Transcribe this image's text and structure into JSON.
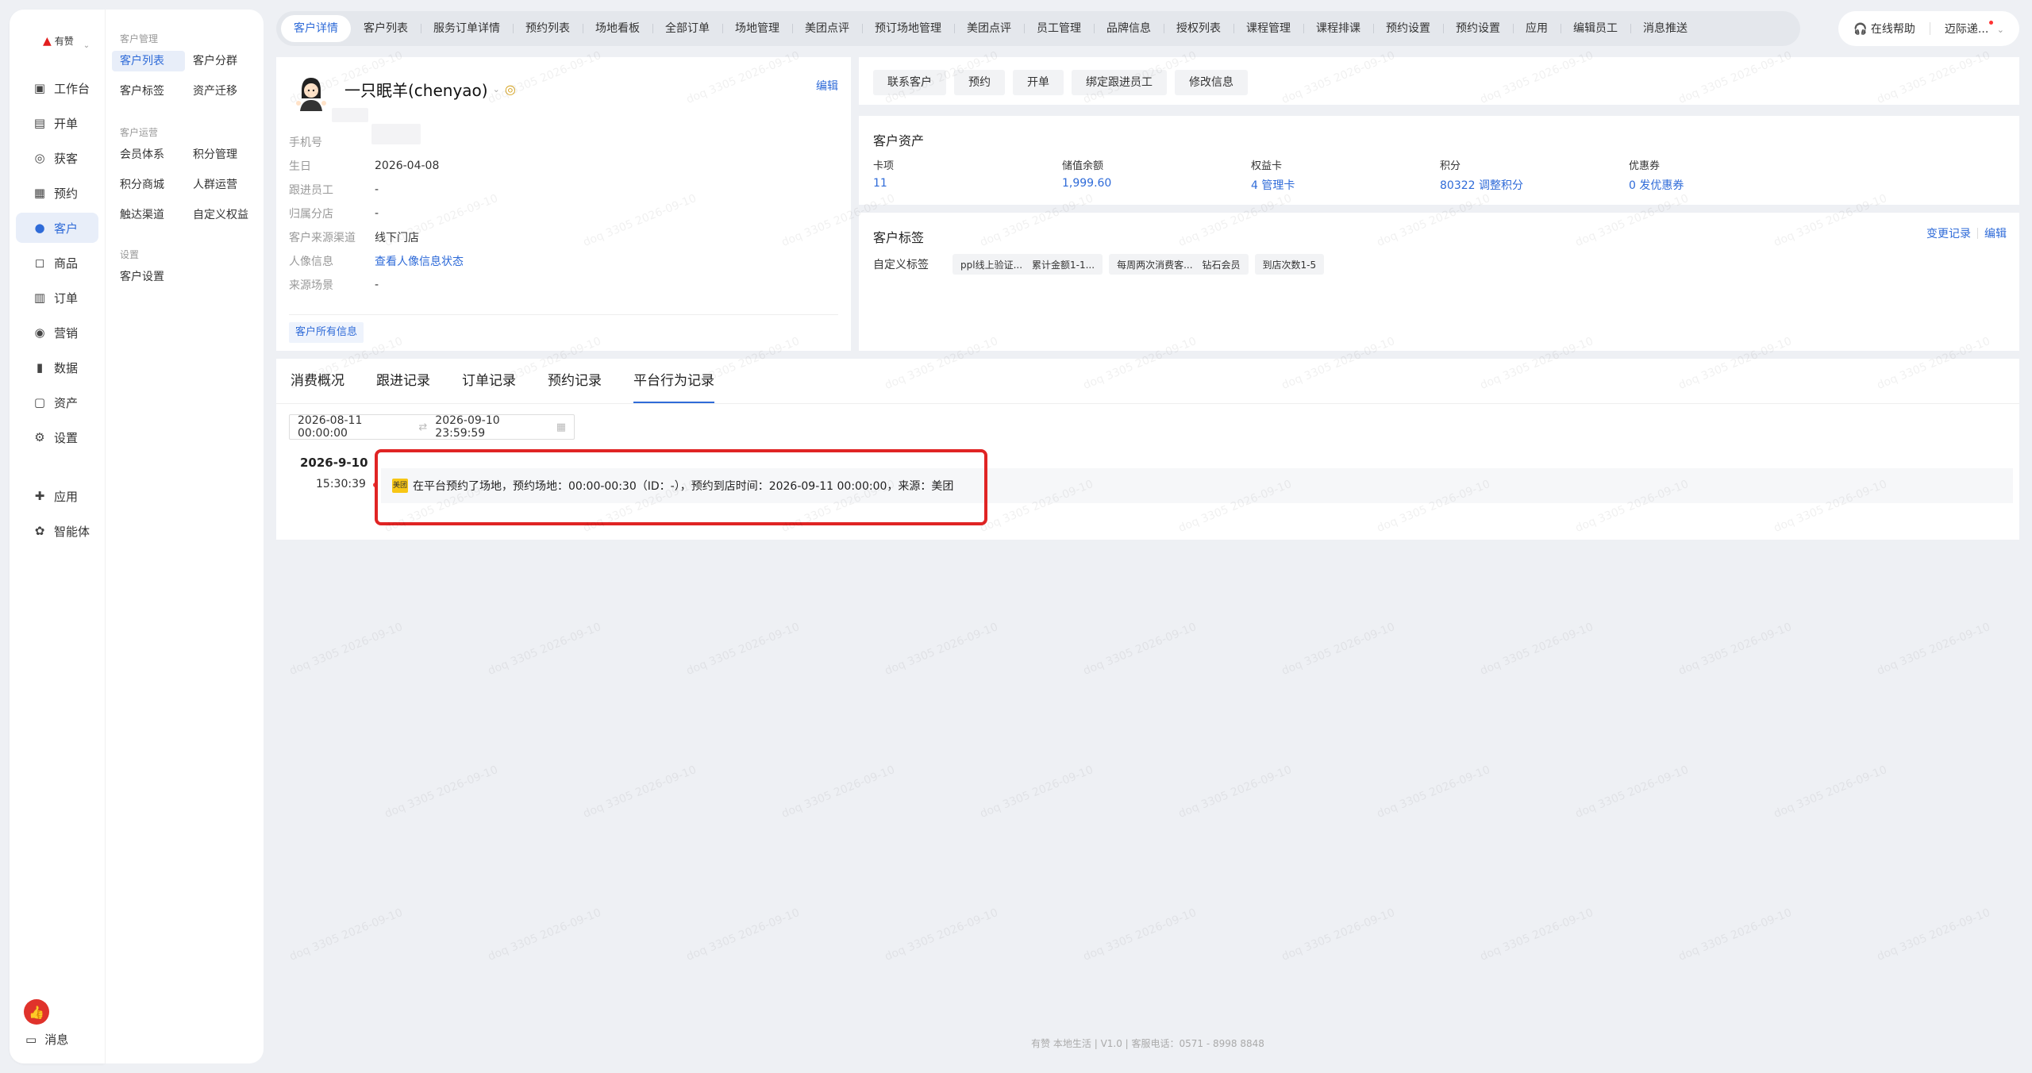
{
  "brand": {
    "name": "有赞",
    "accent": "#2f6bd8"
  },
  "rail": {
    "items": [
      {
        "label": "工作台",
        "icon": "workbench-icon",
        "glyph": "▣"
      },
      {
        "label": "开单",
        "icon": "order-open-icon",
        "glyph": "▤"
      },
      {
        "label": "获客",
        "icon": "acquire-icon",
        "glyph": "◎"
      },
      {
        "label": "预约",
        "icon": "calendar-icon",
        "glyph": "▦"
      },
      {
        "label": "客户",
        "icon": "user-icon",
        "glyph": "●"
      },
      {
        "label": "商品",
        "icon": "bag-icon",
        "glyph": "◻"
      },
      {
        "label": "订单",
        "icon": "orders-icon",
        "glyph": "▥"
      },
      {
        "label": "营销",
        "icon": "marketing-icon",
        "glyph": "◉"
      },
      {
        "label": "数据",
        "icon": "chart-icon",
        "glyph": "▮"
      },
      {
        "label": "资产",
        "icon": "asset-icon",
        "glyph": "▢"
      },
      {
        "label": "设置",
        "icon": "settings-icon",
        "glyph": "⚙"
      }
    ],
    "extra": [
      {
        "label": "应用",
        "icon": "apps-icon",
        "glyph": "✚"
      },
      {
        "label": "智能体",
        "icon": "agent-icon",
        "glyph": "✿"
      }
    ],
    "message_label": "消息"
  },
  "submenu": {
    "group1": "客户管理",
    "group1_items": [
      "客户列表",
      "客户分群",
      "客户标签",
      "资产迁移"
    ],
    "group2": "客户运营",
    "group2_items": [
      "会员体系",
      "积分管理",
      "积分商城",
      "人群运营",
      "触达渠道",
      "自定义权益"
    ],
    "group3": "设置",
    "group3_items": [
      "客户设置"
    ]
  },
  "tabs": [
    "客户详情",
    "客户列表",
    "服务订单详情",
    "预约列表",
    "场地看板",
    "全部订单",
    "场地管理",
    "美团点评",
    "预订场地管理",
    "美团点评",
    "员工管理",
    "品牌信息",
    "授权列表",
    "课程管理",
    "课程排课",
    "预约设置",
    "预约设置",
    "应用",
    "编辑员工",
    "消息推送"
  ],
  "topright": {
    "help": "在线帮助",
    "user": "迈际递..."
  },
  "profile": {
    "name": "一只眠羊(chenyao)",
    "edit": "编辑",
    "rows": [
      {
        "k": "手机号",
        "v": ""
      },
      {
        "k": "生日",
        "v": "2026-04-08"
      },
      {
        "k": "跟进员工",
        "v": "-"
      },
      {
        "k": "归属分店",
        "v": "-"
      },
      {
        "k": "客户来源渠道",
        "v": "线下门店"
      },
      {
        "k": "人像信息",
        "v": "查看人像信息状态"
      },
      {
        "k": "来源场景",
        "v": "-"
      }
    ],
    "all_info": "客户所有信息"
  },
  "actions": [
    "联系客户",
    "预约",
    "开单",
    "绑定跟进员工",
    "修改信息"
  ],
  "assets": {
    "title": "客户资产",
    "items": [
      {
        "k": "卡项",
        "v": "11"
      },
      {
        "k": "储值余额",
        "v": "1,999.60"
      },
      {
        "k": "权益卡",
        "v": "4 管理卡"
      },
      {
        "k": "积分",
        "v": "80322 调整积分"
      },
      {
        "k": "优惠券",
        "v": "0 发优惠券"
      }
    ]
  },
  "tags": {
    "title": "客户标签",
    "change_log": "变更记录",
    "edit": "编辑",
    "label": "自定义标签",
    "groups": [
      [
        "ppl线上验证...",
        "累计金额1-1..."
      ],
      [
        "每周两次消费客...",
        "钻石会员"
      ],
      [
        "到店次数1-5"
      ]
    ]
  },
  "records": {
    "tabs": [
      "消费概况",
      "跟进记录",
      "订单记录",
      "预约记录",
      "平台行为记录"
    ],
    "range_start": "2026-08-11 00:00:00",
    "range_end": "2026-09-10 23:59:59",
    "date": "2026-9-10",
    "time": "15:30:39",
    "source_icon": "美团",
    "event": "在平台预约了场地，预约场地：00:00-00:30（ID：-），预约到店时间：2026-09-11 00:00:00，来源：美团"
  },
  "footer": "有赞 本地生活  |  V1.0  |  客服电话：0571 - 8998 8848",
  "watermark": "doq 3305 2026-09-10"
}
